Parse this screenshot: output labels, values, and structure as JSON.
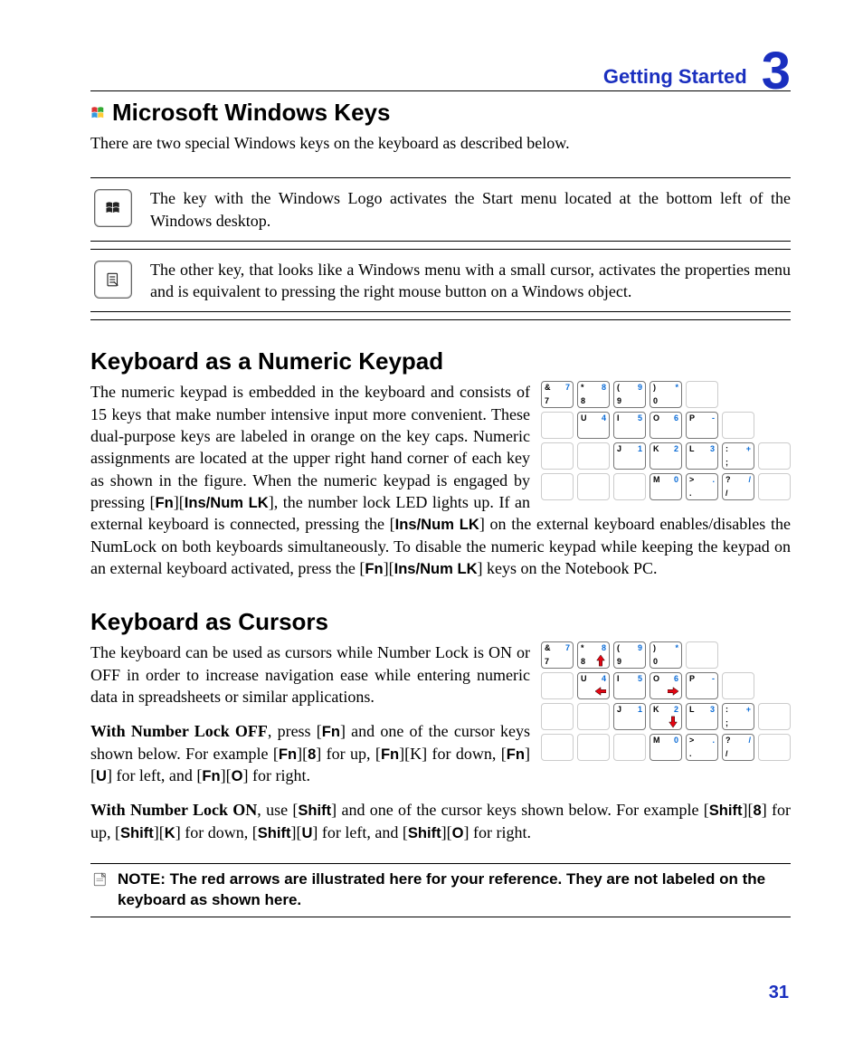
{
  "header": {
    "section": "Getting Started",
    "chapter": "3"
  },
  "page_number": "31",
  "s1": {
    "heading": "Microsoft Windows Keys",
    "intro": "There are two special Windows keys on the keyboard as described below.",
    "row1": "The key with the Windows Logo activates the Start menu located at the bottom left of the Windows desktop.",
    "row2": "The other key, that looks like a Windows menu with a small cursor, activates the properties menu and is equivalent to pressing the right mouse button on a Windows object."
  },
  "s2": {
    "heading": "Keyboard as a Numeric Keypad",
    "p_a": "The numeric keypad is embedded in the keyboard and consists of 15 keys that make number intensive input more convenient. These dual-purpose keys are labeled in orange on the key caps. Numeric assignments are located at the upper right hand corner of each key as shown in the figure. When the numeric keypad is engaged by pressing [",
    "k_fn": "Fn",
    "p_b": "][",
    "k_ins": "Ins/Num LK",
    "p_c": "], the number lock LED lights up. If an external keyboard is connected, pressing the [",
    "p_d": "] on the external keyboard enables/disables the NumLock on both keyboards simultaneously. To disable the numeric keypad while keeping the keypad on an external keyboard activated, press the  [",
    "p_e": "] keys on the Notebook PC."
  },
  "s3": {
    "heading": "Keyboard as Cursors",
    "p1": "The keyboard can be used as cursors while Number Lock is ON or OFF in order to increase navigation ease while entering numeric data in spreadsheets or similar applications.",
    "p2_lead": "With Number Lock OFF",
    "p2_a": ", press [",
    "k_fn": "Fn",
    "p2_b": "] and one of the cursor keys shown below. For example [",
    "p2_c": "][",
    "k_8": "8",
    "p2_d": "] for up, [",
    "p2_e": "][K] for down, [",
    "p2_f": "][",
    "k_U": "U",
    "p2_g": "] for left, and [",
    "p2_h": "][",
    "k_O": "O",
    "p2_i": "] for right.",
    "p3_lead": "With Number Lock ON",
    "p3_a": ", use [",
    "k_shift": "Shift",
    "p3_b": "] and one of the cursor keys shown below. For example [",
    "p3_c": "][",
    "p3_d": "] for up, [",
    "p3_e": "][",
    "k_K": "K",
    "p3_f": "] for down, [",
    "p3_g": "][",
    "p3_h": "] for left, and [",
    "p3_i": "][",
    "p3_j": "] for right."
  },
  "note": "NOTE: The red arrows are illustrated here for your reference. They are not labeled on the keyboard as shown here.",
  "keypad": {
    "r1": [
      {
        "tl": "&",
        "tr": "7",
        "bl": "7"
      },
      {
        "tl": "*",
        "tr": "8",
        "bl": "8"
      },
      {
        "tl": "(",
        "tr": "9",
        "bl": "9"
      },
      {
        "tl": ")",
        "tr": "*",
        "bl": "0"
      }
    ],
    "r2": [
      {
        "tl": "U",
        "tr": "4"
      },
      {
        "tl": "I",
        "tr": "5"
      },
      {
        "tl": "O",
        "tr": "6"
      },
      {
        "tl": "P",
        "tr": "-"
      }
    ],
    "r3": [
      {
        "tl": "J",
        "tr": "1"
      },
      {
        "tl": "K",
        "tr": "2"
      },
      {
        "tl": "L",
        "tr": "3"
      },
      {
        "tl": ":",
        "tr": "+",
        "bl": ";"
      }
    ],
    "r4": [
      {
        "tl": "M",
        "tr": "0"
      },
      {
        "tl": ">",
        "tr": ".",
        "bl": "."
      },
      {
        "tl": "?",
        "tr": "/",
        "bl": "/"
      }
    ]
  }
}
